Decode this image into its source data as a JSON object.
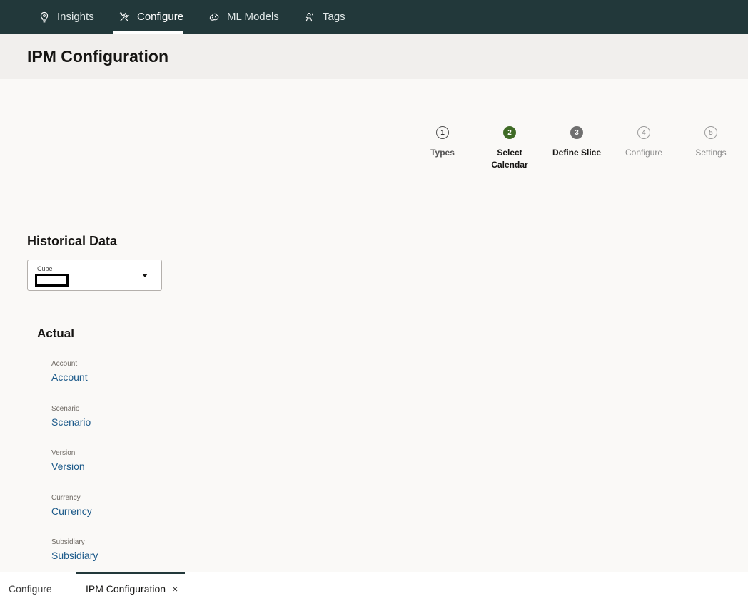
{
  "nav": {
    "items": [
      {
        "label": "Insights",
        "icon": "bulb-icon"
      },
      {
        "label": "Configure",
        "icon": "tools-icon"
      },
      {
        "label": "ML Models",
        "icon": "ml-models-icon"
      },
      {
        "label": "Tags",
        "icon": "tags-icon"
      }
    ],
    "active": "Configure",
    "background": "#22383a"
  },
  "page": {
    "title": "IPM Configuration"
  },
  "stepper": {
    "steps": [
      {
        "number": "1",
        "label": "Types",
        "state": "visited"
      },
      {
        "number": "2",
        "label": "Select Calendar",
        "state": "current"
      },
      {
        "number": "3",
        "label": "Define Slice",
        "state": "next"
      },
      {
        "number": "4",
        "label": "Configure",
        "state": "future"
      },
      {
        "number": "5",
        "label": "Settings",
        "state": "future"
      }
    ],
    "current_color": "#3f6b26"
  },
  "historical": {
    "title": "Historical Data",
    "cube_label": "Cube",
    "cube_value": ""
  },
  "actual": {
    "title": "Actual",
    "fields": [
      {
        "label": "Account",
        "value": "Account"
      },
      {
        "label": "Scenario",
        "value": "Scenario"
      },
      {
        "label": "Version",
        "value": "Version"
      },
      {
        "label": "Currency",
        "value": "Currency"
      },
      {
        "label": "Subsidiary",
        "value": "Subsidiary"
      }
    ]
  },
  "bottom_tabs": {
    "tabs": [
      {
        "label": "Configure"
      },
      {
        "label": "IPM Configuration"
      }
    ],
    "close_glyph": "×"
  }
}
